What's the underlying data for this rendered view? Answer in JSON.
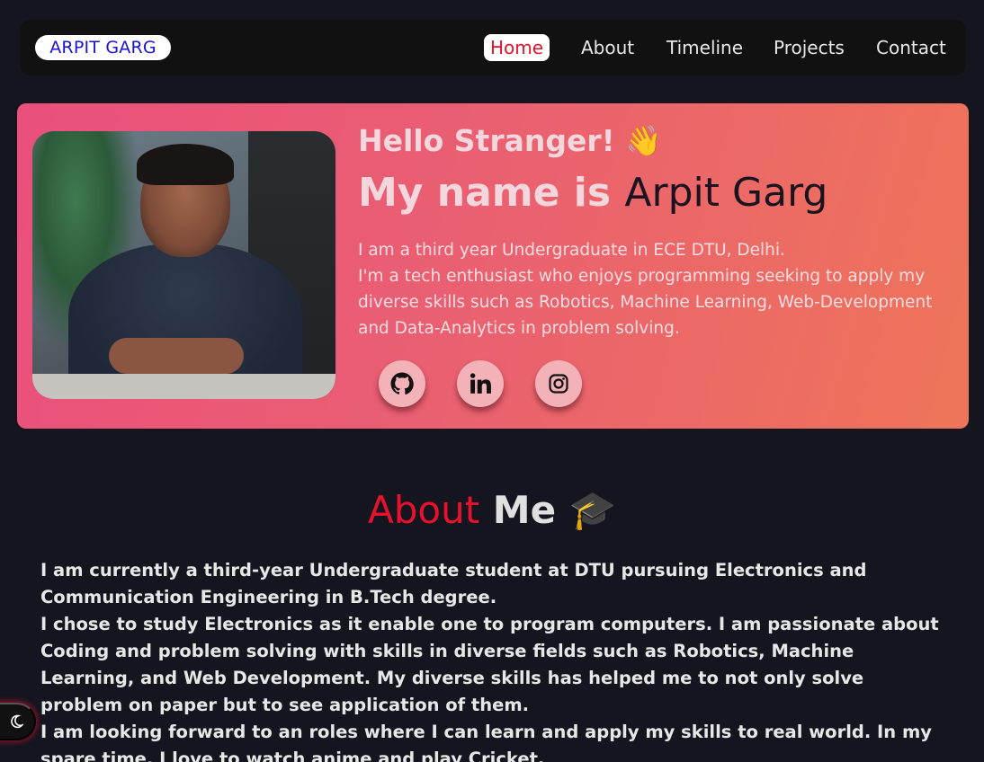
{
  "nav": {
    "logo": "ARPIT GARG",
    "items": [
      {
        "label": "Home",
        "active": true
      },
      {
        "label": "About",
        "active": false
      },
      {
        "label": "Timeline",
        "active": false
      },
      {
        "label": "Projects",
        "active": false
      },
      {
        "label": "Contact",
        "active": false
      }
    ]
  },
  "hero": {
    "greeting": "Hello Stranger!",
    "greeting_emoji": "👋",
    "name_prefix": "My name is",
    "name": "Arpit Garg",
    "bio": [
      "I am a third year Undergraduate in ECE DTU, Delhi.",
      "I'm a tech enthusiast who enjoys programming seeking to apply my diverse skills such as Robotics, Machine Learning, Web-Development and Data-Analytics in problem solving."
    ],
    "social": [
      "github-icon",
      "linkedin-icon",
      "instagram-icon"
    ],
    "photo_icon": "profile-photo"
  },
  "about": {
    "title_part1": "About",
    "title_part2": "Me",
    "title_emoji": "🎓",
    "paragraphs": [
      "I am currently a third-year Undergraduate student at DTU pursuing Electronics and Communication Engineering in B.Tech degree.",
      "I chose to study Electronics as it enable one to program computers. I am passionate about Coding and problem solving with skills in diverse fields such as Robotics, Machine Learning, and Web Development. My diverse skills has helped me to not only solve problem on paper but to see application of them.",
      "I am looking forward to an roles where I can learn and apply my skills to real world. In my spare time, I love to watch anime and play Cricket."
    ]
  },
  "theme_toggle_icon": "moon-icon",
  "colors": {
    "accent": "#e8112d",
    "background": "#14151f",
    "logo_text": "#1a13d6"
  }
}
